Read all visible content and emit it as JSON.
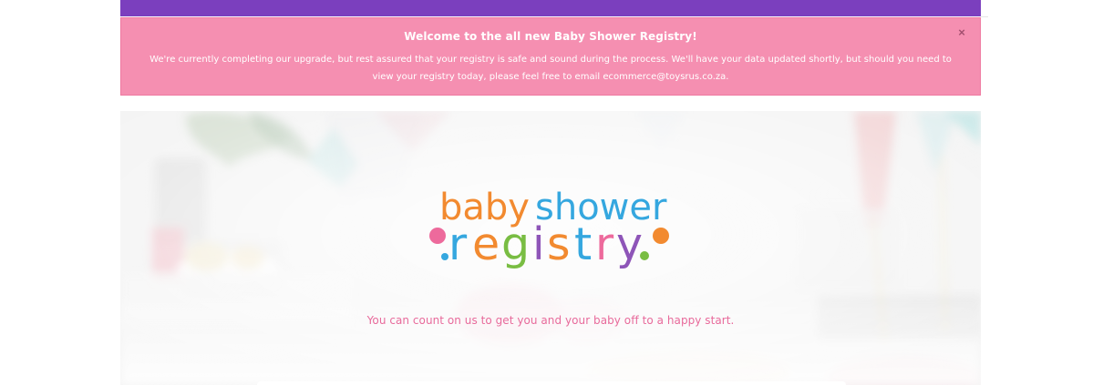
{
  "alert": {
    "title": "Welcome to the all new Baby Shower Registry!",
    "line1": "We're currently completing our upgrade, but rest assured that your registry is safe and sound during the process. We'll have your data updated shortly, but should you need to",
    "line2": "view your registry today, please feel free to email ecommerce@toysrus.co.za.",
    "close_label": "×"
  },
  "hero": {
    "logo": {
      "word1": "baby",
      "word2": "shower",
      "word3_letters": [
        "r",
        "e",
        "g",
        "i",
        "s",
        "t",
        "r",
        "y"
      ]
    },
    "tagline": "You can count on us to get you and your baby off to a happy start."
  },
  "colors": {
    "header_bar": "#7b3fbe",
    "alert_background": "#f58fb1",
    "tagline": "#e86a9b",
    "logo_orange": "#f28a30",
    "logo_blue": "#35a7df",
    "logo_green": "#79bd43",
    "logo_pink": "#ed6a9c",
    "logo_purple": "#8e55b8"
  }
}
